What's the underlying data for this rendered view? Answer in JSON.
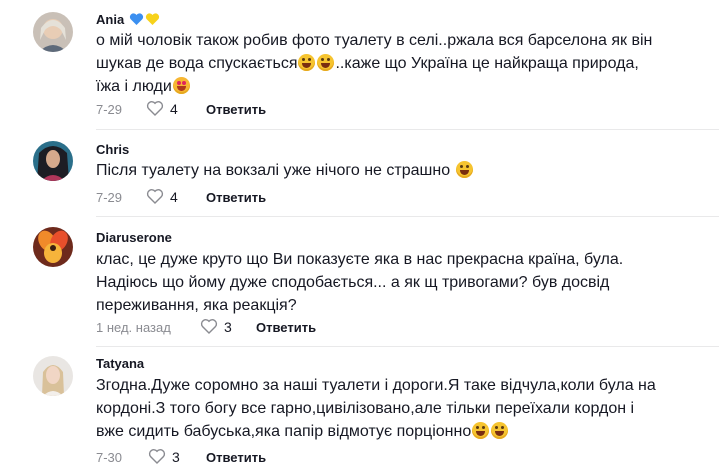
{
  "comments": [
    {
      "username": "Ania",
      "text_lines": [
        "о мій чоловік також робив фото туалету в селі..ржала вся барселона як він",
        "шукав де вода спускається",
        "..каже що Україна це найкраща природа,",
        "їжа і люди"
      ],
      "date": "7-29",
      "likes": "4",
      "reply": "Ответить"
    },
    {
      "username": "Chris",
      "text_lines": [
        "Після туалету на вокзалі уже нічого не страшно "
      ],
      "date": "7-29",
      "likes": "4",
      "reply": "Ответить"
    },
    {
      "username": "Diaruserone",
      "text_lines": [
        "клас, це дуже круто що Ви показуєте яка в нас прекрасна країна, була.",
        "Надіюсь що йому дуже сподобається... а як щ тривогами? був досвід",
        "переживання, яка реакція?"
      ],
      "date": "1 нед. назад",
      "likes": "3",
      "reply": "Ответить"
    },
    {
      "username": "Tatyana",
      "text_lines": [
        "Згодна.Дуже соромно за наші туалети і дороги.Я таке відчула,коли була на",
        "кордоні.З того богу все гарно,цивілізовано,але тільки переїхали кордон і",
        "вже сидить бабуська,яка папір відмотує порціонно"
      ],
      "date": "7-30",
      "likes": "3",
      "reply": "Ответить"
    }
  ],
  "colors": {
    "text": "#161823",
    "muted": "#8a8b91",
    "divider": "#e9e9ea"
  }
}
